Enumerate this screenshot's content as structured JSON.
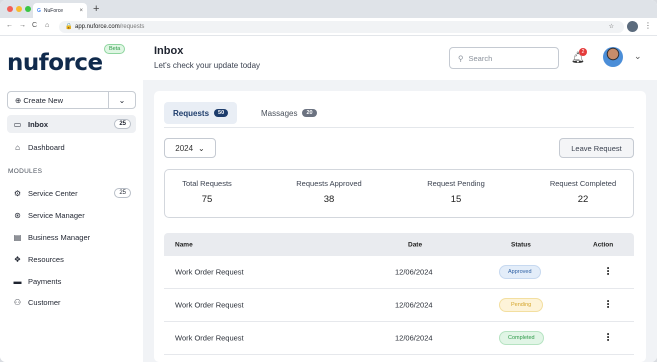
{
  "browser": {
    "tab_title": "NuForce",
    "url_host": "app.nuforce.com",
    "url_path": "/requests"
  },
  "sidebar": {
    "logo": "nuforce",
    "beta": "Beta",
    "create_label": "Create New",
    "inbox": {
      "label": "Inbox",
      "count": "25"
    },
    "dashboard": {
      "label": "Dashboard"
    },
    "section": "MODULES",
    "modules": [
      {
        "label": "Service Center",
        "count": "25",
        "icon": "gear-icon"
      },
      {
        "label": "Service Manager",
        "icon": "support-icon"
      },
      {
        "label": "Business Manager",
        "icon": "database-icon"
      },
      {
        "label": "Resources",
        "icon": "resources-icon"
      },
      {
        "label": "Payments",
        "icon": "card-icon"
      },
      {
        "label": "Customer",
        "icon": "users-icon"
      }
    ]
  },
  "header": {
    "title": "Inbox",
    "subtitle": "Let's check your update today",
    "search_placeholder": "Search",
    "notifications": "2"
  },
  "tabs": [
    {
      "label": "Requests",
      "count": "50",
      "color": "#1d3c6b"
    },
    {
      "label": "Massages",
      "count": "20",
      "color": "#6b7280"
    }
  ],
  "filter": {
    "year": "2024",
    "leave_label": "Leave Request"
  },
  "stats": [
    {
      "label": "Total Requests",
      "value": "75"
    },
    {
      "label": "Requests Approved",
      "value": "38"
    },
    {
      "label": "Request Pending",
      "value": "15"
    },
    {
      "label": "Request Completed",
      "value": "22"
    }
  ],
  "table": {
    "headers": {
      "name": "Name",
      "date": "Date",
      "status": "Status",
      "action": "Action"
    },
    "rows": [
      {
        "name": "Work Order Request",
        "date": "12/06/2024",
        "status": "Approved",
        "bg": "#e3edf9",
        "fg": "#2d5fa3",
        "border": "#c7d9f0"
      },
      {
        "name": "Work Order Request",
        "date": "12/06/2024",
        "status": "Pending",
        "bg": "#fdf3d8",
        "fg": "#d4a52b",
        "border": "#f3dfa0"
      },
      {
        "name": "Work Order Request",
        "date": "12/06/2024",
        "status": "Completed",
        "bg": "#e1f5e6",
        "fg": "#2f9a4a",
        "border": "#b6e3c2"
      }
    ]
  }
}
